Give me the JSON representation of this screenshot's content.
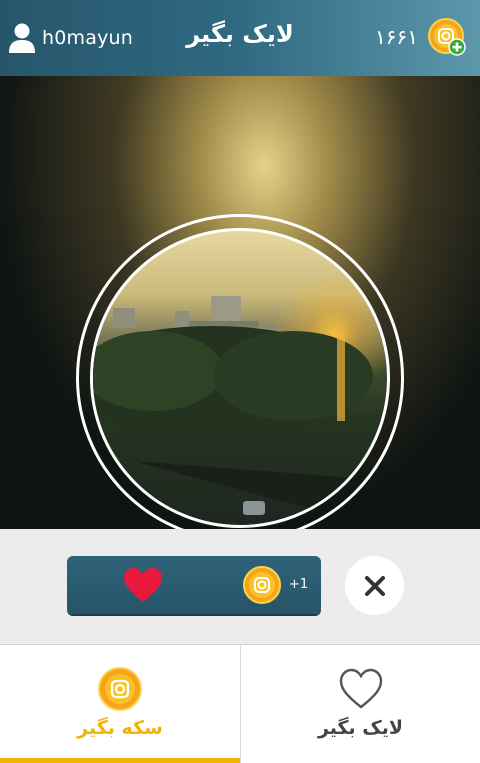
{
  "header": {
    "username": "h0mayun",
    "title": "لایک بگیر",
    "coin_count": "۱۶۶۱"
  },
  "like_button": {
    "reward": "+1"
  },
  "tabs": [
    {
      "label": "سکه بگیر",
      "icon": "coin-icon",
      "active": true
    },
    {
      "label": "لایک بگیر",
      "icon": "heart-outline-icon",
      "active": false
    }
  ],
  "colors": {
    "header": "#2f6a82",
    "accent": "#f2b400",
    "heart": "#e8193c",
    "button": "#2a5b70"
  }
}
